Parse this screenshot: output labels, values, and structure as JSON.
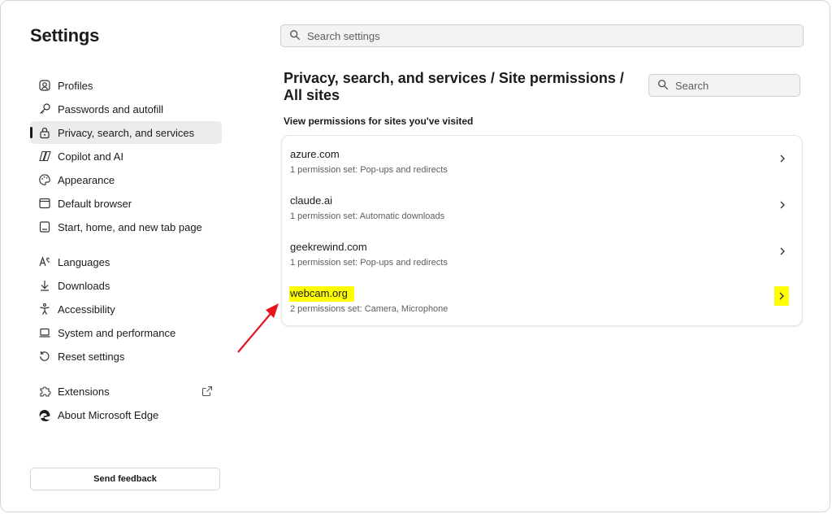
{
  "window": {
    "title": "Settings"
  },
  "search": {
    "placeholder": "Search settings"
  },
  "sidebar": {
    "items": [
      {
        "label": "Profiles",
        "icon": "profile-icon"
      },
      {
        "label": "Passwords and autofill",
        "icon": "key-icon"
      },
      {
        "label": "Privacy, search, and services",
        "icon": "lock-icon",
        "active": true
      },
      {
        "label": "Copilot and AI",
        "icon": "copilot-icon"
      },
      {
        "label": "Appearance",
        "icon": "palette-icon"
      },
      {
        "label": "Default browser",
        "icon": "browser-icon"
      },
      {
        "label": "Start, home, and new tab page",
        "icon": "home-icon"
      },
      {
        "label": "Languages",
        "icon": "language-icon"
      },
      {
        "label": "Downloads",
        "icon": "download-icon"
      },
      {
        "label": "Accessibility",
        "icon": "accessibility-icon"
      },
      {
        "label": "System and performance",
        "icon": "laptop-icon"
      },
      {
        "label": "Reset settings",
        "icon": "reset-icon"
      },
      {
        "label": "Extensions",
        "icon": "puzzle-icon"
      },
      {
        "label": "About Microsoft Edge",
        "icon": "edge-icon"
      }
    ],
    "feedback_label": "Send feedback"
  },
  "main": {
    "breadcrumb": "Privacy, search, and services  /  Site permissions  /  All sites",
    "site_search_placeholder": "Search",
    "heading": "View permissions for sites you've visited",
    "sites": [
      {
        "name": "azure.com",
        "permissions": "1 permission set: Pop-ups and redirects"
      },
      {
        "name": "claude.ai",
        "permissions": "1 permission set: Automatic downloads"
      },
      {
        "name": "geekrewind.com",
        "permissions": "1 permission set: Pop-ups and redirects"
      },
      {
        "name": "webcam.org",
        "permissions": "2 permissions set: Camera, Microphone",
        "highlighted": true
      }
    ]
  },
  "colors": {
    "highlight": "#ffff00",
    "annotation_arrow": "#e8141c",
    "active_bg": "#ececec"
  }
}
